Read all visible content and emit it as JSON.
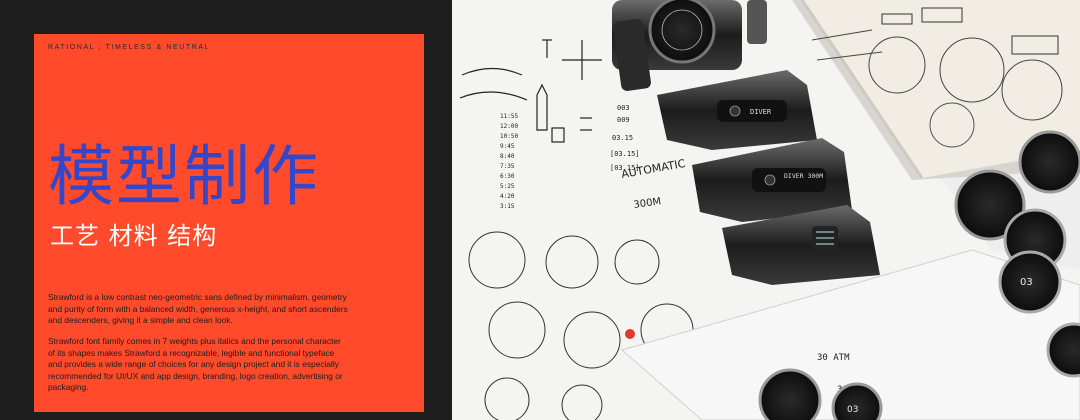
{
  "tagline": "RATIONAL , TIMELESS & NEUTRAL",
  "title": "模型制作",
  "subtitle": "工艺 材料 结构",
  "paragraphs": [
    "Strawford is a low contrast neo-geometric sans defined by minimalism, geometry and purity of form with a balanced width, generous x-height, and short ascenders and descenders, giving it a simple and clean look.",
    "Strawford font family comes in 7 weights plus italics and the personal character of its shapes makes Strawford a recognizable, legible and functional typeface and provides a wide range of choices for any design project and it is especially recommended for UI/UX and app design, branding, logo creation, advertising or packaging."
  ],
  "photo": {
    "case_labels": [
      "DIVER",
      "DIVER 300M"
    ],
    "sketch_text": [
      "AUTOMATIC",
      "300M"
    ],
    "dial_labels": [
      "30 ATM",
      "30 ATM",
      "03",
      "03"
    ],
    "time_list": [
      "11:55",
      "12:00",
      "10:50",
      "9:45",
      "8:40",
      "7:35",
      "6:30",
      "5:25",
      "4:20",
      "3:15"
    ],
    "date_list": [
      "003",
      "009",
      "03.15",
      "[03.15]",
      "[03.15]"
    ],
    "colors": {
      "panel": "#ff4a2b",
      "title": "#3646c8",
      "frame": "#1e1e1e"
    }
  }
}
